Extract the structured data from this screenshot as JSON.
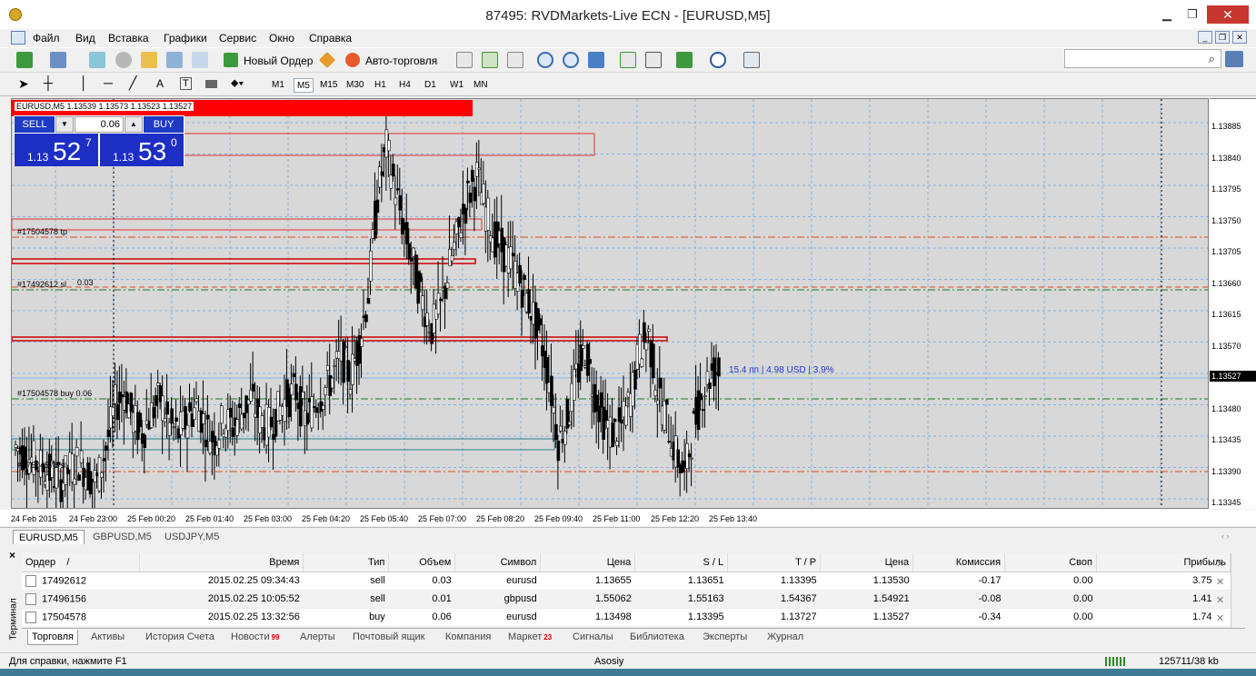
{
  "window": {
    "title": "87495: RVDMarkets-Live ECN - [EURUSD,M5]"
  },
  "menu": [
    "Файл",
    "Вид",
    "Вставка",
    "Графики",
    "Сервис",
    "Окно",
    "Справка"
  ],
  "toolbar": {
    "new_order": "Новый Ордер",
    "auto_trading": "Авто-торговля"
  },
  "timeframes": [
    "M1",
    "M5",
    "M15",
    "M30",
    "H1",
    "H4",
    "D1",
    "W1",
    "MN"
  ],
  "chart_header": {
    "symbol_line": "EURUSD,M5  1.13539 1.13573 1.13523 1.13527"
  },
  "one_click": {
    "sell": "SELL",
    "buy": "BUY",
    "volume": "0.06",
    "bid_small": "1.13",
    "bid_big": "52",
    "bid_sup": "7",
    "ask_small": "1.13",
    "ask_big": "53",
    "ask_sup": "0"
  },
  "chart_labels": {
    "order1": "#17504578 tp",
    "order2": "#17492612 sl",
    "order2b": "0.03",
    "order3": "#17504578 buy 0.06",
    "order4": "#17504578 sl",
    "profit_label": "15.4 пп | 4.98 USD | 3.9%"
  },
  "colors": {
    "bull": "#000000",
    "bear": "#000000",
    "grid": "#7fb2e5",
    "sl_line": "#e0471a",
    "buy_line": "#1a7a1a",
    "rect_red": "#e03030",
    "rect_teal": "#2a7f8f"
  },
  "chart_data": {
    "type": "candlestick",
    "symbol": "EURUSD",
    "timeframe": "M5",
    "price_ticks": [
      "1.13885",
      "1.13840",
      "1.13795",
      "1.13750",
      "1.13705",
      "1.13660",
      "1.13615",
      "1.13570",
      "1.13525",
      "1.13480",
      "1.13435",
      "1.13390",
      "1.13345"
    ],
    "current_price": "1.13527",
    "ylim": [
      1.1333,
      1.1392
    ],
    "time_ticks": [
      "24 Feb 2015",
      "24 Feb 23:00",
      "25 Feb 00:20",
      "25 Feb 01:40",
      "25 Feb 03:00",
      "25 Feb 04:20",
      "25 Feb 05:40",
      "25 Feb 07:00",
      "25 Feb 08:20",
      "25 Feb 09:40",
      "25 Feb 11:00",
      "25 Feb 12:20",
      "25 Feb 13:40"
    ],
    "hlines": [
      {
        "price": 1.13728,
        "kind": "sl"
      },
      {
        "price": 1.13655,
        "kind": "buy"
      },
      {
        "price": 1.13498,
        "kind": "buy"
      },
      {
        "price": 1.13395,
        "kind": "sl"
      },
      {
        "price": 1.13651,
        "kind": "mixed"
      }
    ],
    "close_path": [
      1.1342,
      1.1341,
      1.134,
      1.1339,
      1.1338,
      1.1337,
      1.1339,
      1.134,
      1.1338,
      1.1337,
      1.1342,
      1.1348,
      1.135,
      1.1346,
      1.1344,
      1.1347,
      1.1349,
      1.1345,
      1.1344,
      1.1346,
      1.1348,
      1.1345,
      1.1343,
      1.1346,
      1.1345,
      1.1347,
      1.1349,
      1.1346,
      1.1345,
      1.1347,
      1.1349,
      1.135,
      1.1346,
      1.1348,
      1.135,
      1.1352,
      1.1355,
      1.1352,
      1.1357,
      1.1364,
      1.1378,
      1.1385,
      1.1379,
      1.1373,
      1.1368,
      1.1363,
      1.1359,
      1.1362,
      1.1368,
      1.1373,
      1.1378,
      1.1381,
      1.1376,
      1.1372,
      1.137,
      1.1368,
      1.1365,
      1.1362,
      1.1358,
      1.1352,
      1.1343,
      1.1346,
      1.1352,
      1.1356,
      1.135,
      1.1346,
      1.1344,
      1.1345,
      1.1349,
      1.1356,
      1.1358,
      1.135,
      1.1346,
      1.1341,
      1.1338,
      1.1345,
      1.135,
      1.1353
    ]
  },
  "chart_tabs": [
    "EURUSD,M5",
    "GBPUSD,M5",
    "USDJPY,M5"
  ],
  "orders": {
    "columns": [
      "Ордер",
      "/",
      "Время",
      "Тип",
      "Объем",
      "Символ",
      "Цена",
      "S / L",
      "T / P",
      "Цена",
      "Комиссия",
      "Своп",
      "Прибыль"
    ],
    "rows": [
      {
        "order": "17492612",
        "time": "2015.02.25 09:34:43",
        "type": "sell",
        "volume": "0.03",
        "symbol": "eurusd",
        "price": "1.13655",
        "sl": "1.13651",
        "tp": "1.13395",
        "cur": "1.13530",
        "commission": "-0.17",
        "swap": "0.00",
        "profit": "3.75"
      },
      {
        "order": "17496156",
        "time": "2015.02.25 10:05:52",
        "type": "sell",
        "volume": "0.01",
        "symbol": "gbpusd",
        "price": "1.55062",
        "sl": "1.55163",
        "tp": "1.54367",
        "cur": "1.54921",
        "commission": "-0.08",
        "swap": "0.00",
        "profit": "1.41"
      },
      {
        "order": "17504578",
        "time": "2015.02.25 13:32:56",
        "type": "buy",
        "volume": "0.06",
        "symbol": "eurusd",
        "price": "1.13498",
        "sl": "1.13395",
        "tp": "1.13727",
        "cur": "1.13527",
        "commission": "-0.34",
        "swap": "0.00",
        "profit": "1.74"
      }
    ]
  },
  "terminal": {
    "side_label": "Терминал",
    "close": "×"
  },
  "terminal_tabs": [
    {
      "label": "Торговля",
      "badge": ""
    },
    {
      "label": "Активы",
      "badge": ""
    },
    {
      "label": "История Счета",
      "badge": ""
    },
    {
      "label": "Новости",
      "badge": "99"
    },
    {
      "label": "Алерты",
      "badge": ""
    },
    {
      "label": "Почтовый ящик",
      "badge": ""
    },
    {
      "label": "Компания",
      "badge": ""
    },
    {
      "label": "Маркет",
      "badge": "23"
    },
    {
      "label": "Сигналы",
      "badge": ""
    },
    {
      "label": "Библиотека",
      "badge": ""
    },
    {
      "label": "Эксперты",
      "badge": ""
    },
    {
      "label": "Журнал",
      "badge": ""
    }
  ],
  "status": {
    "help": "Для справки, нажмите F1",
    "profile": "Asosiy",
    "traffic": "125711/38 kb"
  }
}
